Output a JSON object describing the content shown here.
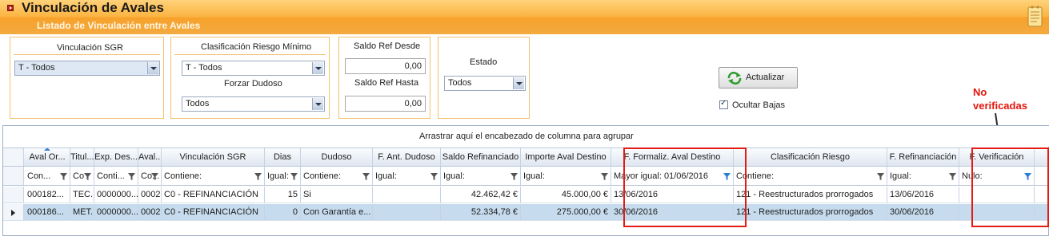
{
  "header": {
    "title": "Vinculación de Avales",
    "subtitle": "Listado de Vinculación entre Avales"
  },
  "filters": {
    "vinculacion_sgr": {
      "label": "Vinculación SGR",
      "value": "T - Todos"
    },
    "clasificacion_riesgo": {
      "label": "Clasificación Riesgo Mínimo",
      "value": "T - Todos"
    },
    "forzar_dudoso": {
      "label": "Forzar Dudoso",
      "value": "Todos"
    },
    "saldo_desde": {
      "label": "Saldo Ref Desde",
      "value": "0,00"
    },
    "saldo_hasta": {
      "label": "Saldo Ref Hasta",
      "value": "0,00"
    },
    "estado": {
      "label": "Estado",
      "value": "Todos"
    },
    "actualizar_label": "Actualizar",
    "ocultar_bajas_label": "Ocultar Bajas",
    "ocultar_bajas_checked": true
  },
  "annotation": {
    "line1": "No",
    "line2": "verificadas"
  },
  "grid": {
    "group_hint": "Arrastrar aquí el encabezado de columna para agrupar",
    "columns": [
      {
        "header": "Aval Or...",
        "filter": "Con..."
      },
      {
        "header": "Titul...",
        "filter": "Co"
      },
      {
        "header": "Exp. Des...",
        "filter": "Conti..."
      },
      {
        "header": "Aval...",
        "filter": "Co..."
      },
      {
        "header": "Vinculación SGR",
        "filter": "Contiene:"
      },
      {
        "header": "Dias",
        "filter": "Igual:"
      },
      {
        "header": "Dudoso",
        "filter": "Contiene:"
      },
      {
        "header": "F. Ant. Dudoso",
        "filter": "Igual:"
      },
      {
        "header": "Saldo Refinanciado",
        "filter": "Igual:"
      },
      {
        "header": "Importe Aval Destino",
        "filter": "Igual:"
      },
      {
        "header": "F. Formaliz. Aval Destino",
        "filter": "Mayor igual: 01/06/2016"
      },
      {
        "header": "Clasificación Riesgo",
        "filter": "Contiene:"
      },
      {
        "header": "F. Refinanciación",
        "filter": "Igual:"
      },
      {
        "header": "F. Verificación",
        "filter": "Nulo:"
      }
    ],
    "rows": [
      [
        "000182...",
        "TEC...",
        "0000000...",
        "0002...",
        "C0 - REFINANCIACIÓN",
        "15",
        "Si",
        "",
        "42.462,42 €",
        "45.000,00 €",
        "13/06/2016",
        "121 - Reestructurados prorrogados",
        "13/06/2016",
        ""
      ],
      [
        "000186...",
        "MET...",
        "0000000...",
        "0002...",
        "C0 - REFINANCIACIÓN",
        "0",
        "Con Garantía e...",
        "",
        "52.334,78 €",
        "275.000,00 €",
        "30/06/2016",
        "121 - Reestructurados prorrogados",
        "30/06/2016",
        ""
      ]
    ]
  },
  "colors": {
    "accent": "#f6a22c",
    "highlight": "#e11d16",
    "selected_row": "#c6dcee"
  }
}
